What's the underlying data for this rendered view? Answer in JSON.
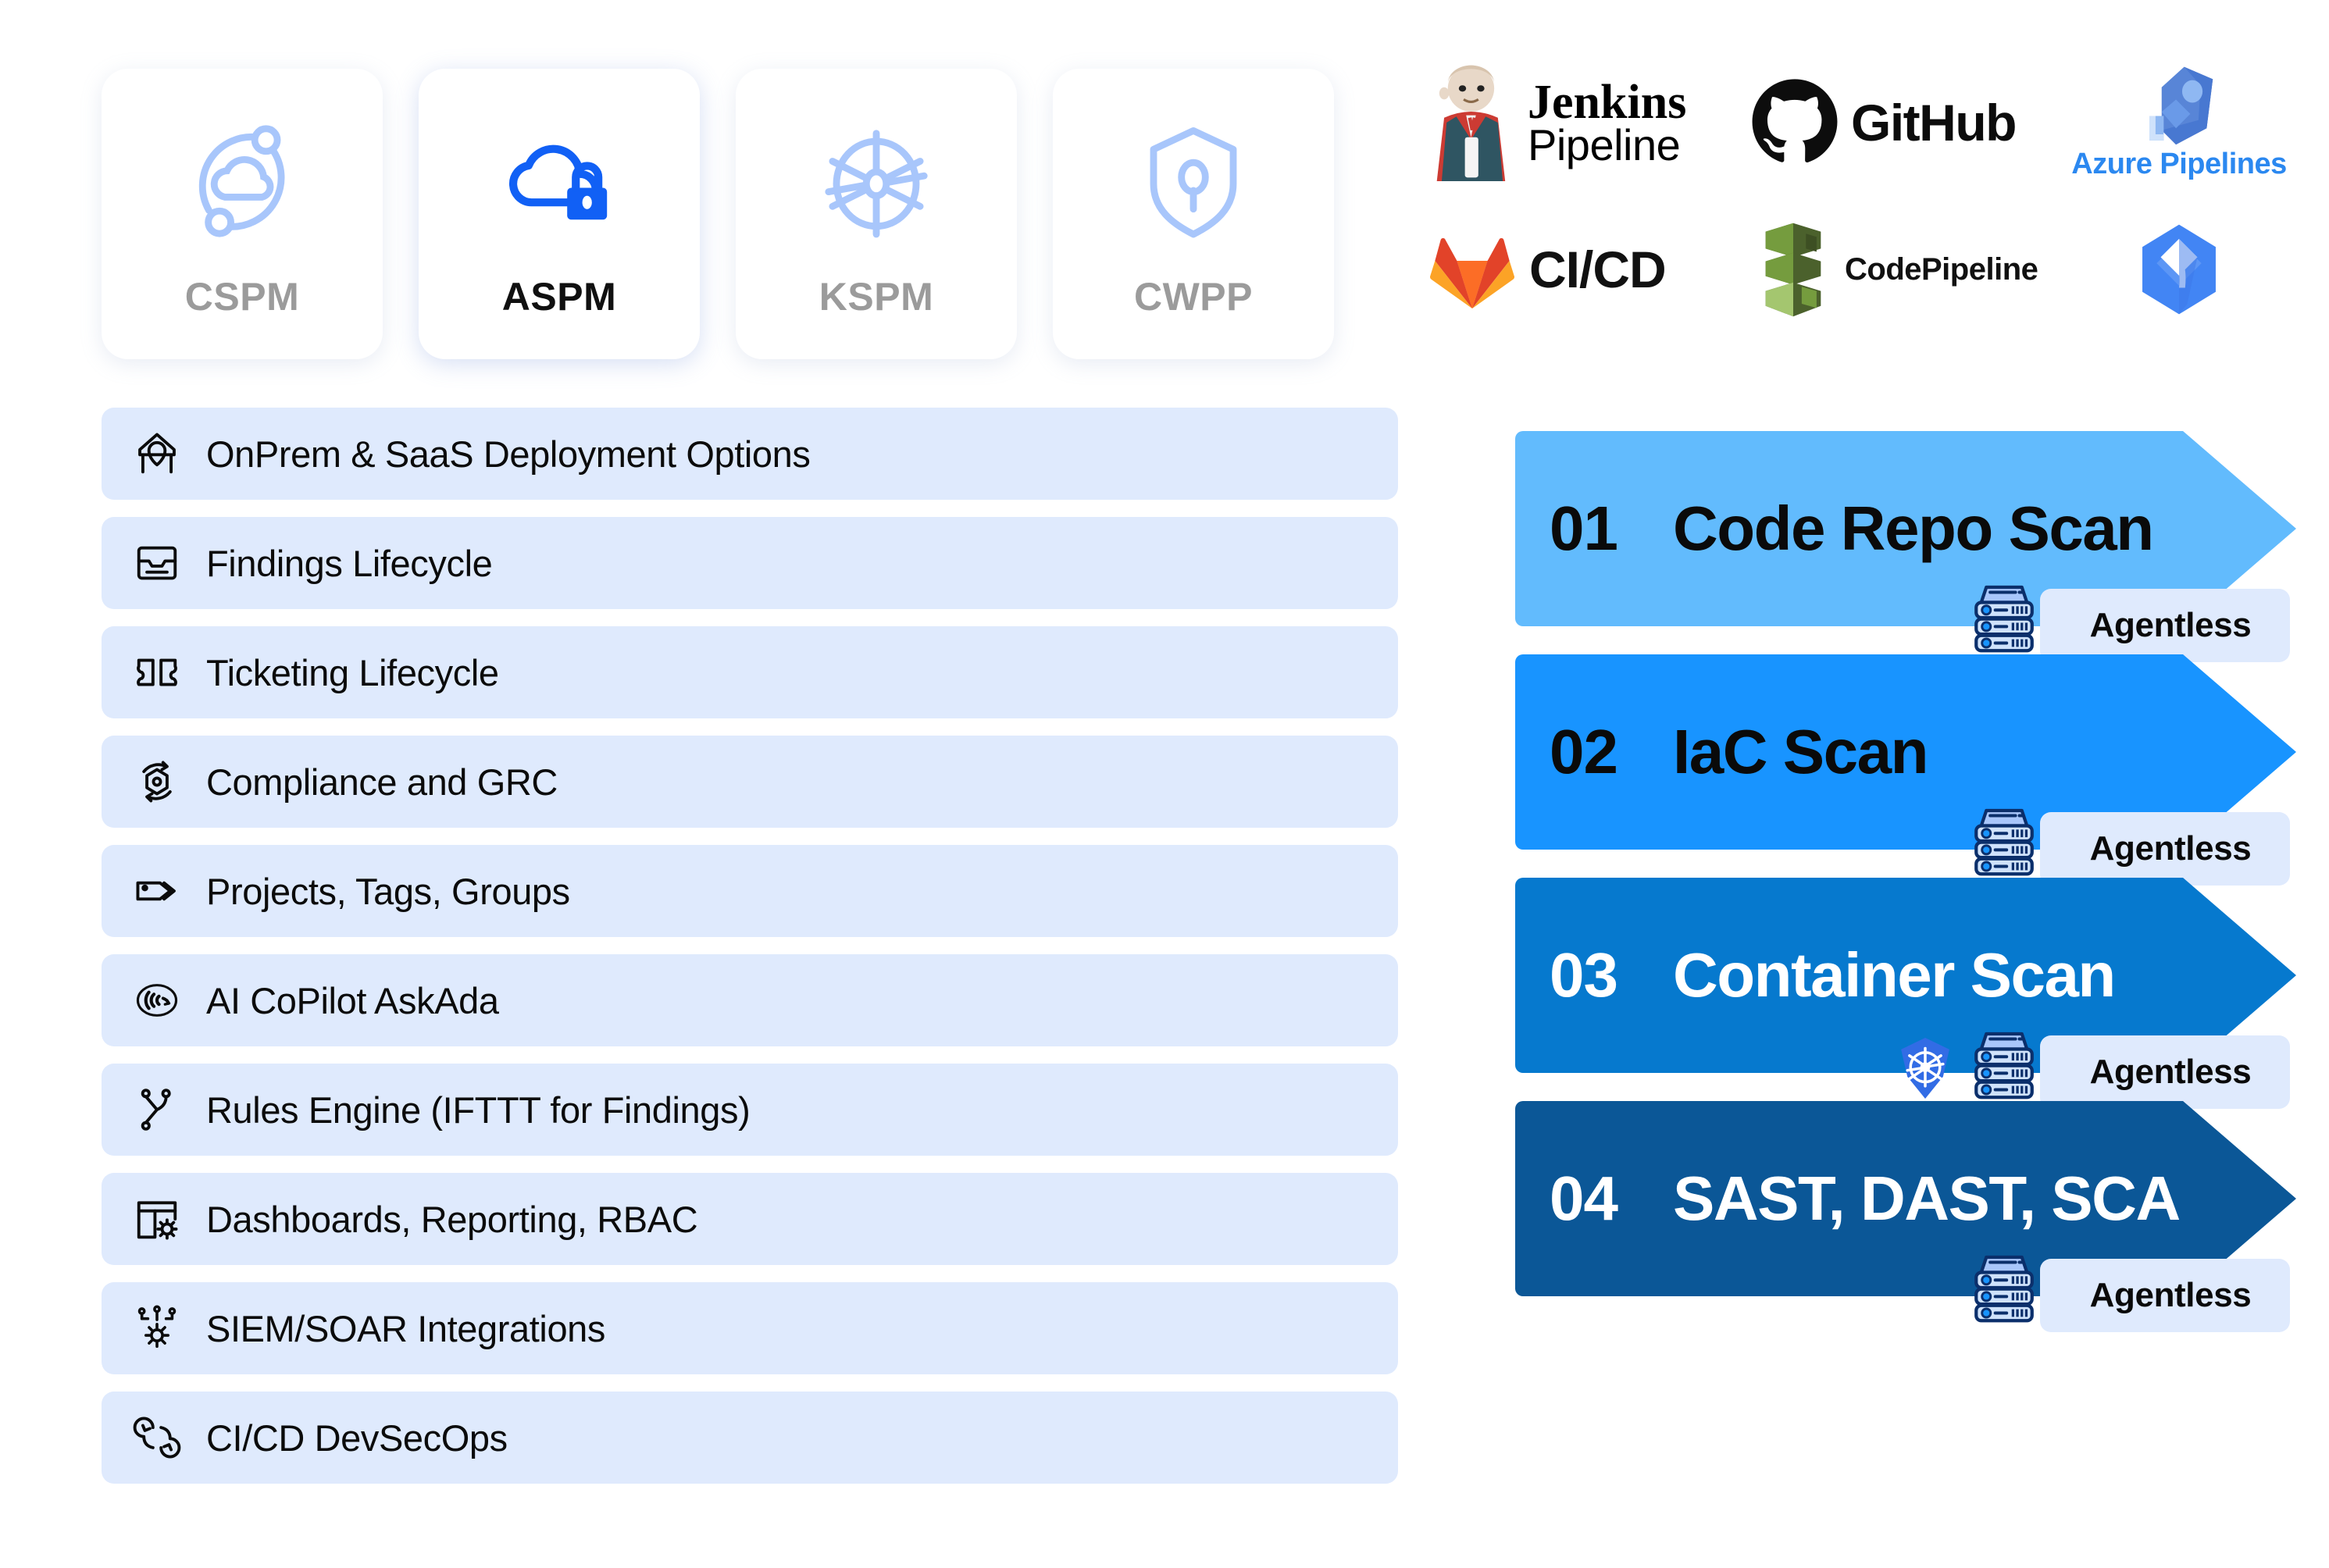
{
  "pillars": [
    {
      "label": "CSPM",
      "icon": "cloud-orbit-icon",
      "active": false
    },
    {
      "label": "ASPM",
      "icon": "cloud-lock-icon",
      "active": true
    },
    {
      "label": "KSPM",
      "icon": "kubernetes-helm-icon",
      "active": false
    },
    {
      "label": "CWPP",
      "icon": "shield-keyhole-icon",
      "active": false
    }
  ],
  "logos": [
    {
      "name": "jenkins-pipeline-logo",
      "line1": "Jenkins",
      "line2": "Pipeline"
    },
    {
      "name": "github-logo",
      "line1": "GitHub"
    },
    {
      "name": "azure-pipelines-logo",
      "line1": "Azure Pipelines"
    },
    {
      "name": "gitlab-cicd-logo",
      "line1": "CI/CD"
    },
    {
      "name": "aws-codepipeline-logo",
      "line1": "CodePipeline"
    },
    {
      "name": "google-cloud-build-logo",
      "line1": ""
    }
  ],
  "features": [
    {
      "icon": "onprem-house-icon",
      "label": "OnPrem & SaaS Deployment Options"
    },
    {
      "icon": "inbox-tray-icon",
      "label": "Findings Lifecycle"
    },
    {
      "icon": "ticket-icon",
      "label": "Ticketing Lifecycle"
    },
    {
      "icon": "compliance-cycle-icon",
      "label": "Compliance and GRC"
    },
    {
      "icon": "tag-icon",
      "label": "Projects, Tags, Groups"
    },
    {
      "icon": "ai-copilot-icon",
      "label": "AI CoPilot AskAda"
    },
    {
      "icon": "rules-branch-icon",
      "label": "Rules Engine (IFTTT for Findings)"
    },
    {
      "icon": "dashboard-gear-icon",
      "label": "Dashboards, Reporting, RBAC"
    },
    {
      "icon": "siem-soar-gear-icon",
      "label": "SIEM/SOAR Integrations"
    },
    {
      "icon": "cicd-loop-icon",
      "label": "CI/CD DevSecOps"
    }
  ],
  "scans": [
    {
      "num": "01",
      "title": "Code Repo Scan",
      "badge": "Agentless",
      "color": "#62bbfd",
      "k8s": false
    },
    {
      "num": "02",
      "title": "IaC Scan",
      "badge": "Agentless",
      "color": "#1894ff",
      "k8s": false
    },
    {
      "num": "03",
      "title": "Container Scan",
      "badge": "Agentless",
      "color": "#0679ce",
      "k8s": true
    },
    {
      "num": "04",
      "title": "SAST, DAST, SCA",
      "badge": "Agentless",
      "color": "#0b5797",
      "k8s": false
    }
  ],
  "colors": {
    "pillar_icon_inactive": "#a8c6fb",
    "pillar_icon_active": "#1160f5",
    "feature_bg": "#dfeafd",
    "badge_bg": "#dfeafd"
  }
}
